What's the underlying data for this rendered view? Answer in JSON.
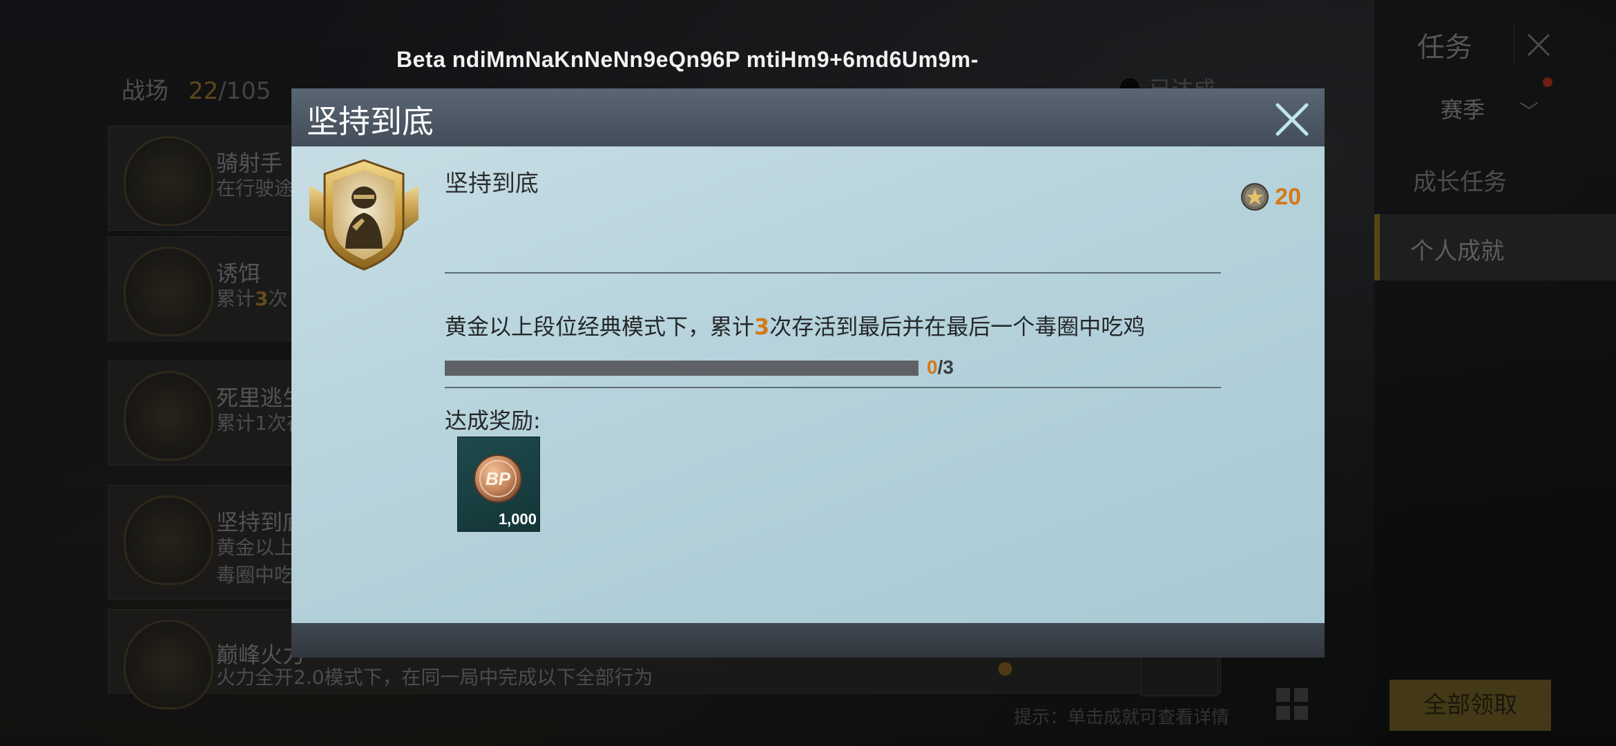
{
  "watermark": "Beta ndiMmNaKnNeNn9eQn96P mtiHm9+6md6Um9m-",
  "background": {
    "list_title": "战场",
    "list_count": "22",
    "list_total": "/105",
    "done_label": "已达成",
    "rows": [
      {
        "name": "骑射手",
        "desc": "在行驶途"
      },
      {
        "name": "诱饵",
        "desc_pre": "累计",
        "desc_hl": "3",
        "desc_post": "次"
      },
      {
        "name": "死里逃生",
        "desc": "累计1次存"
      },
      {
        "name": "坚持到底",
        "desc": "黄金以上",
        "desc2": "毒圈中吃"
      },
      {
        "name": "巅峰火力",
        "desc": "火力全开2.0模式下，在同一局中完成以下全部行为"
      }
    ],
    "side": {
      "task_title": "任务",
      "season": "赛季",
      "growth": "成长任务",
      "personal": "个人成就"
    },
    "claim_all": "全部领取",
    "tip": "提示：单击成就可查看详情"
  },
  "modal": {
    "title": "坚持到底",
    "achievement_name": "坚持到底",
    "points": "20",
    "desc_pre": "黄金以上段位经典模式下，累计",
    "desc_hl": "3",
    "desc_post": "次存活到最后并在最后一个毒圈中吃鸡",
    "progress_current": "0",
    "progress_total": "/3",
    "progress_fraction": 0,
    "reward_label": "达成奖励:",
    "reward_amount": "1,000",
    "reward_icon": "bp-coin-icon"
  },
  "colors": {
    "accent_orange": "#d47a17",
    "modal_body": "#b9d4dc",
    "header": "#4b5663"
  }
}
